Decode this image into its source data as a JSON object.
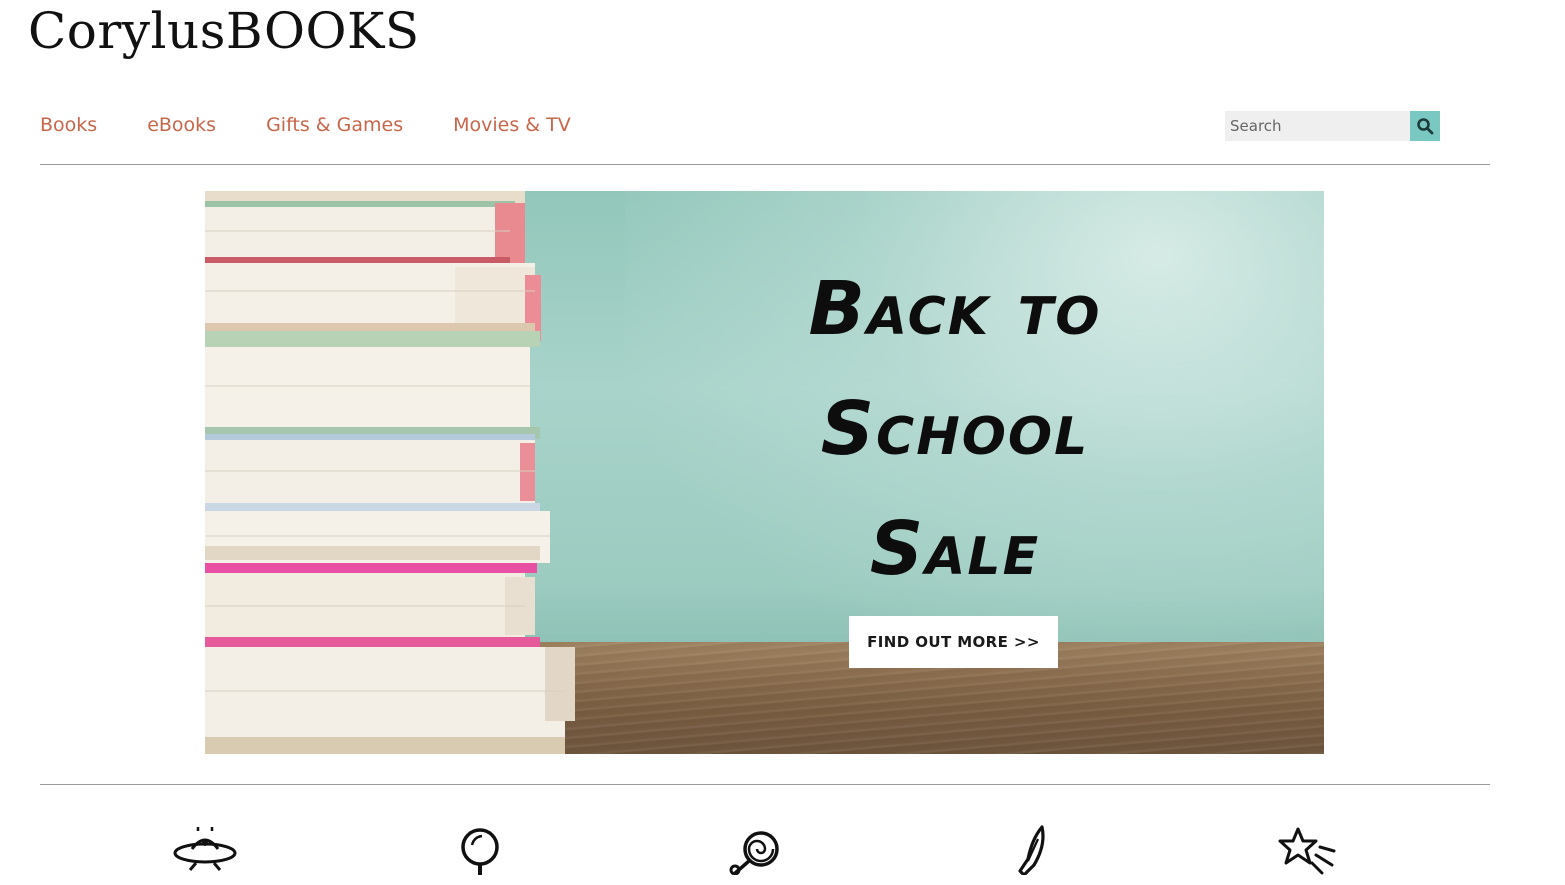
{
  "site": {
    "title": "CorylusBOOKS"
  },
  "nav": {
    "items": [
      "Books",
      "eBooks",
      "Gifts & Games",
      "Movies & TV"
    ]
  },
  "search": {
    "placeholder": "Search",
    "icon": "search-icon"
  },
  "hero": {
    "heading_lines": [
      "Back to",
      "School",
      "Sale"
    ],
    "cta_label": "FIND OUT MORE >>"
  },
  "categories": {
    "icons": [
      "ufo-icon",
      "magnifying-glass-icon",
      "lollipop-icon",
      "fountain-pen-icon",
      "shooting-star-icon"
    ]
  },
  "colors": {
    "nav_link": "#c8664a",
    "search_button": "#79c9c2",
    "divider": "#9a9a9a"
  }
}
